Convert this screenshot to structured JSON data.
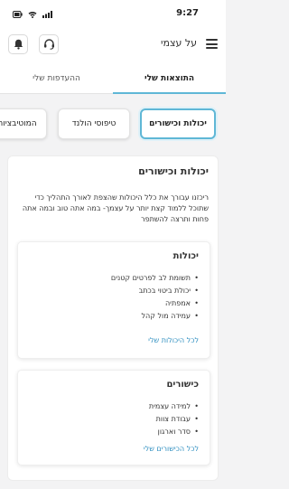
{
  "status_bar": {
    "time": "9:27"
  },
  "header": {
    "title": "על עצמי",
    "menu_icon": "hamburger-icon",
    "notifications_icon": "bell-icon",
    "support_icon": "headset-icon"
  },
  "tabs": [
    {
      "label": "התוצאות שלי",
      "active": true
    },
    {
      "label": "ההעדפות שלי",
      "active": false
    }
  ],
  "chips": [
    {
      "label": "יכולות וכישורים",
      "active": true
    },
    {
      "label": "טיפוסי הולנד",
      "active": false
    },
    {
      "label": "המוטיבציות",
      "active": false
    }
  ],
  "panel": {
    "title": "יכולות וכישורים",
    "description": "ריכזנו עבורך את כלל היכולות שהצפת לאורך התהליך כדי שתוכל ללמוד קצת יותר על עצמך- במה אתה טוב ובמה אתה פחות ותרצה להשתפר"
  },
  "abilities": {
    "title": "יכולות",
    "items": [
      "תשומת לב לפרטים קטנים",
      "יכולת ביטוי בכתב",
      "אמפתיה",
      "עמידה מול קהל"
    ],
    "link": "לכל היכולות שלי"
  },
  "skills": {
    "title": "כישורים",
    "items": [
      "למידה עצמית",
      "עבודת צוות",
      "סדר וארגון"
    ],
    "link": "לכל הכישורים שלי"
  },
  "colors": {
    "accent": "#5fb7d6",
    "link": "#2f8fc0",
    "background": "#f3f3f4"
  }
}
